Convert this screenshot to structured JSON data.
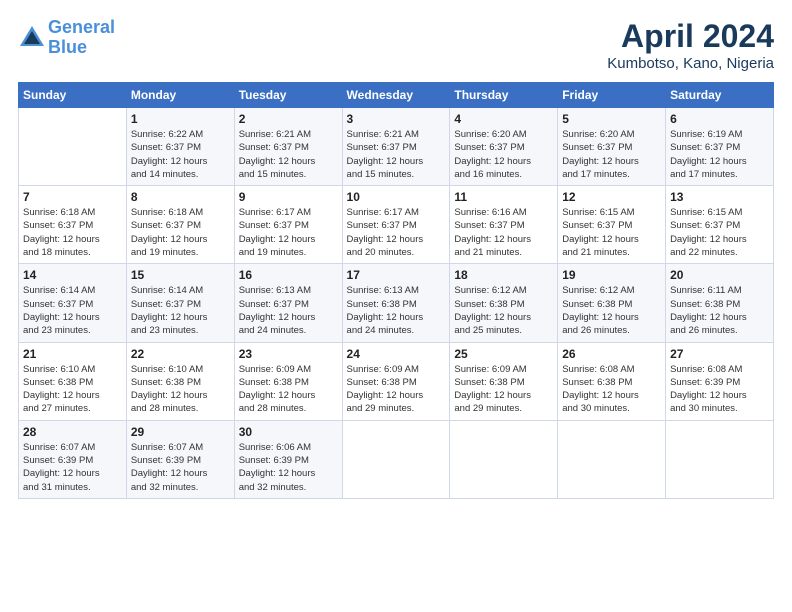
{
  "header": {
    "logo_line1": "General",
    "logo_line2": "Blue",
    "month": "April 2024",
    "location": "Kumbotso, Kano, Nigeria"
  },
  "days_of_week": [
    "Sunday",
    "Monday",
    "Tuesday",
    "Wednesday",
    "Thursday",
    "Friday",
    "Saturday"
  ],
  "weeks": [
    [
      {
        "day": "",
        "info": ""
      },
      {
        "day": "1",
        "info": "Sunrise: 6:22 AM\nSunset: 6:37 PM\nDaylight: 12 hours\nand 14 minutes."
      },
      {
        "day": "2",
        "info": "Sunrise: 6:21 AM\nSunset: 6:37 PM\nDaylight: 12 hours\nand 15 minutes."
      },
      {
        "day": "3",
        "info": "Sunrise: 6:21 AM\nSunset: 6:37 PM\nDaylight: 12 hours\nand 15 minutes."
      },
      {
        "day": "4",
        "info": "Sunrise: 6:20 AM\nSunset: 6:37 PM\nDaylight: 12 hours\nand 16 minutes."
      },
      {
        "day": "5",
        "info": "Sunrise: 6:20 AM\nSunset: 6:37 PM\nDaylight: 12 hours\nand 17 minutes."
      },
      {
        "day": "6",
        "info": "Sunrise: 6:19 AM\nSunset: 6:37 PM\nDaylight: 12 hours\nand 17 minutes."
      }
    ],
    [
      {
        "day": "7",
        "info": "Sunrise: 6:18 AM\nSunset: 6:37 PM\nDaylight: 12 hours\nand 18 minutes."
      },
      {
        "day": "8",
        "info": "Sunrise: 6:18 AM\nSunset: 6:37 PM\nDaylight: 12 hours\nand 19 minutes."
      },
      {
        "day": "9",
        "info": "Sunrise: 6:17 AM\nSunset: 6:37 PM\nDaylight: 12 hours\nand 19 minutes."
      },
      {
        "day": "10",
        "info": "Sunrise: 6:17 AM\nSunset: 6:37 PM\nDaylight: 12 hours\nand 20 minutes."
      },
      {
        "day": "11",
        "info": "Sunrise: 6:16 AM\nSunset: 6:37 PM\nDaylight: 12 hours\nand 21 minutes."
      },
      {
        "day": "12",
        "info": "Sunrise: 6:15 AM\nSunset: 6:37 PM\nDaylight: 12 hours\nand 21 minutes."
      },
      {
        "day": "13",
        "info": "Sunrise: 6:15 AM\nSunset: 6:37 PM\nDaylight: 12 hours\nand 22 minutes."
      }
    ],
    [
      {
        "day": "14",
        "info": "Sunrise: 6:14 AM\nSunset: 6:37 PM\nDaylight: 12 hours\nand 23 minutes."
      },
      {
        "day": "15",
        "info": "Sunrise: 6:14 AM\nSunset: 6:37 PM\nDaylight: 12 hours\nand 23 minutes."
      },
      {
        "day": "16",
        "info": "Sunrise: 6:13 AM\nSunset: 6:37 PM\nDaylight: 12 hours\nand 24 minutes."
      },
      {
        "day": "17",
        "info": "Sunrise: 6:13 AM\nSunset: 6:38 PM\nDaylight: 12 hours\nand 24 minutes."
      },
      {
        "day": "18",
        "info": "Sunrise: 6:12 AM\nSunset: 6:38 PM\nDaylight: 12 hours\nand 25 minutes."
      },
      {
        "day": "19",
        "info": "Sunrise: 6:12 AM\nSunset: 6:38 PM\nDaylight: 12 hours\nand 26 minutes."
      },
      {
        "day": "20",
        "info": "Sunrise: 6:11 AM\nSunset: 6:38 PM\nDaylight: 12 hours\nand 26 minutes."
      }
    ],
    [
      {
        "day": "21",
        "info": "Sunrise: 6:10 AM\nSunset: 6:38 PM\nDaylight: 12 hours\nand 27 minutes."
      },
      {
        "day": "22",
        "info": "Sunrise: 6:10 AM\nSunset: 6:38 PM\nDaylight: 12 hours\nand 28 minutes."
      },
      {
        "day": "23",
        "info": "Sunrise: 6:09 AM\nSunset: 6:38 PM\nDaylight: 12 hours\nand 28 minutes."
      },
      {
        "day": "24",
        "info": "Sunrise: 6:09 AM\nSunset: 6:38 PM\nDaylight: 12 hours\nand 29 minutes."
      },
      {
        "day": "25",
        "info": "Sunrise: 6:09 AM\nSunset: 6:38 PM\nDaylight: 12 hours\nand 29 minutes."
      },
      {
        "day": "26",
        "info": "Sunrise: 6:08 AM\nSunset: 6:38 PM\nDaylight: 12 hours\nand 30 minutes."
      },
      {
        "day": "27",
        "info": "Sunrise: 6:08 AM\nSunset: 6:39 PM\nDaylight: 12 hours\nand 30 minutes."
      }
    ],
    [
      {
        "day": "28",
        "info": "Sunrise: 6:07 AM\nSunset: 6:39 PM\nDaylight: 12 hours\nand 31 minutes."
      },
      {
        "day": "29",
        "info": "Sunrise: 6:07 AM\nSunset: 6:39 PM\nDaylight: 12 hours\nand 32 minutes."
      },
      {
        "day": "30",
        "info": "Sunrise: 6:06 AM\nSunset: 6:39 PM\nDaylight: 12 hours\nand 32 minutes."
      },
      {
        "day": "",
        "info": ""
      },
      {
        "day": "",
        "info": ""
      },
      {
        "day": "",
        "info": ""
      },
      {
        "day": "",
        "info": ""
      }
    ]
  ]
}
